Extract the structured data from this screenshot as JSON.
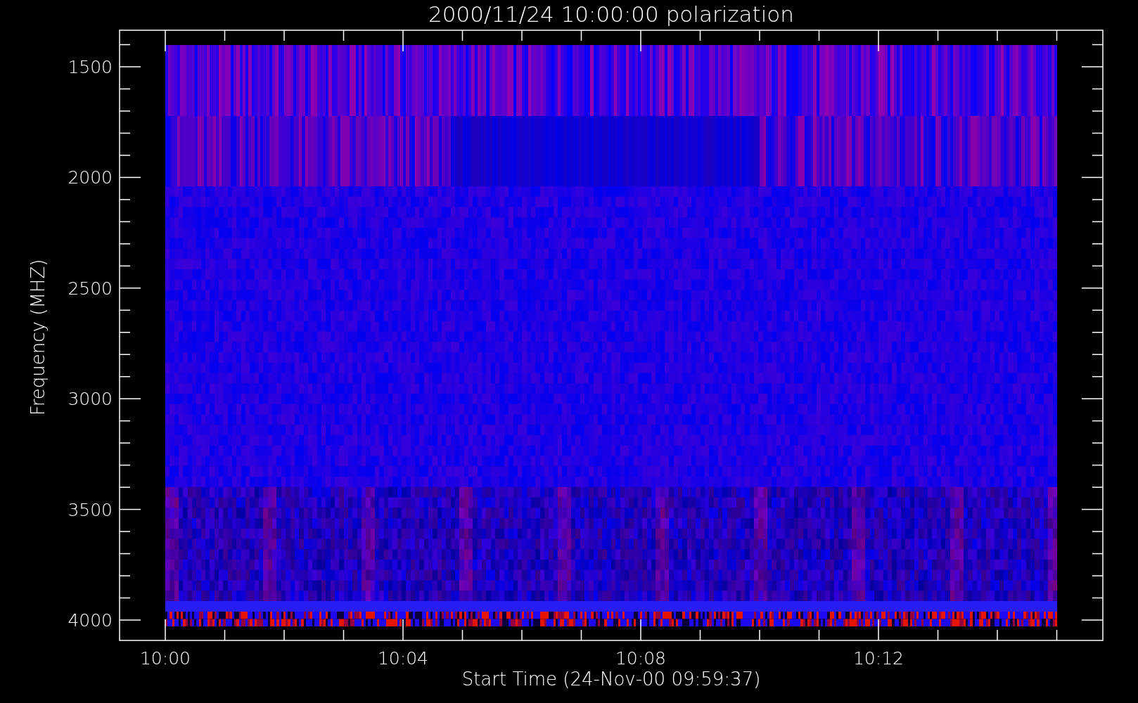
{
  "title": "2000/11/24 10:00:00 polarization",
  "y_axis": {
    "label": "Frequency (MHZ)",
    "ticks": [
      "1500",
      "2000",
      "2500",
      "3000",
      "3500",
      "4000"
    ]
  },
  "x_axis": {
    "label": "Start Time (24-Nov-00 09:59:37)",
    "ticks": [
      "10:00",
      "10:04",
      "10:08",
      "10:12"
    ]
  }
}
